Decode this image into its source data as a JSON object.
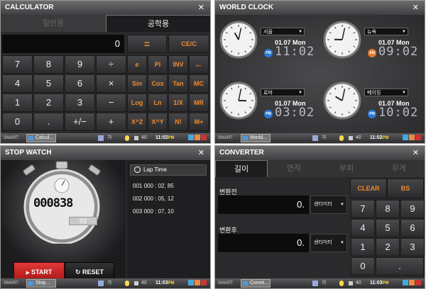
{
  "calculator": {
    "title": "CALCULATOR",
    "close": "✕",
    "tabs": [
      "일반용",
      "공학용"
    ],
    "display": "0",
    "equals": "=",
    "clear": "CE/C",
    "numpad": [
      "7",
      "8",
      "9",
      "÷",
      "4",
      "5",
      "6",
      "×",
      "1",
      "2",
      "3",
      "−",
      "0",
      ".",
      "+/−",
      "+"
    ],
    "sci": [
      "e",
      "Pi",
      "INV",
      "←",
      "Sin",
      "Cos",
      "Tan",
      "MC",
      "Log",
      "Ln",
      "1/X",
      "MR",
      "X^2",
      "X^Y",
      "N!",
      "M+"
    ],
    "taskbar": {
      "smart": "SMART",
      "task": "Calcul...",
      "ime": "가",
      "vol": "40",
      "time": "11:02",
      "ampm": "PM"
    }
  },
  "worldclock": {
    "title": "WORLD CLOCK",
    "close": "✕",
    "cities": [
      {
        "name": "서울",
        "date": "01.07 Mon",
        "ampm": "PM",
        "time": "11:02",
        "badge_color": "#2a7ad8"
      },
      {
        "name": "뉴욕",
        "date": "01.07 Mon",
        "ampm": "AM",
        "time": "09:02",
        "badge_color": "#e8762a"
      },
      {
        "name": "로마",
        "date": "01.07 Mon",
        "ampm": "PM",
        "time": "03:02",
        "badge_color": "#2a7ad8"
      },
      {
        "name": "베이징",
        "date": "01.07 Mon",
        "ampm": "PM",
        "time": "10:02",
        "badge_color": "#2a7ad8"
      }
    ],
    "taskbar": {
      "smart": "SMART",
      "task": "World...",
      "ime": "가",
      "vol": "40",
      "time": "11:02",
      "ampm": "PM"
    }
  },
  "stopwatch": {
    "title": "STOP WATCH",
    "close": "✕",
    "digits": "000838",
    "sub": "03",
    "lap_header": "Lap Time",
    "laps": [
      "001  000 : 02, 85",
      "002  000 : 05, 12",
      "003  000 : 07, 10"
    ],
    "start": "START",
    "reset": "RESET",
    "taskbar": {
      "smart": "SMART",
      "task": "Stop...",
      "ime": "가",
      "vol": "40",
      "time": "11:03",
      "ampm": "PM"
    }
  },
  "converter": {
    "title": "CONVERTER",
    "close": "✕",
    "tabs": [
      "길이",
      "면적",
      "부피",
      "무게"
    ],
    "before_label": "변환전",
    "after_label": "변환후",
    "before_value": "0.",
    "after_value": "0.",
    "unit_before": "센티미터",
    "unit_after": "센티미터",
    "clear": "CLEAR",
    "bs": "BS",
    "keys": [
      "7",
      "8",
      "9",
      "4",
      "5",
      "6",
      "1",
      "2",
      "3",
      "0",
      "."
    ],
    "taskbar": {
      "smart": "SMART",
      "task": "Conve...",
      "ime": "가",
      "vol": "40",
      "time": "11:03",
      "ampm": "PM"
    }
  }
}
